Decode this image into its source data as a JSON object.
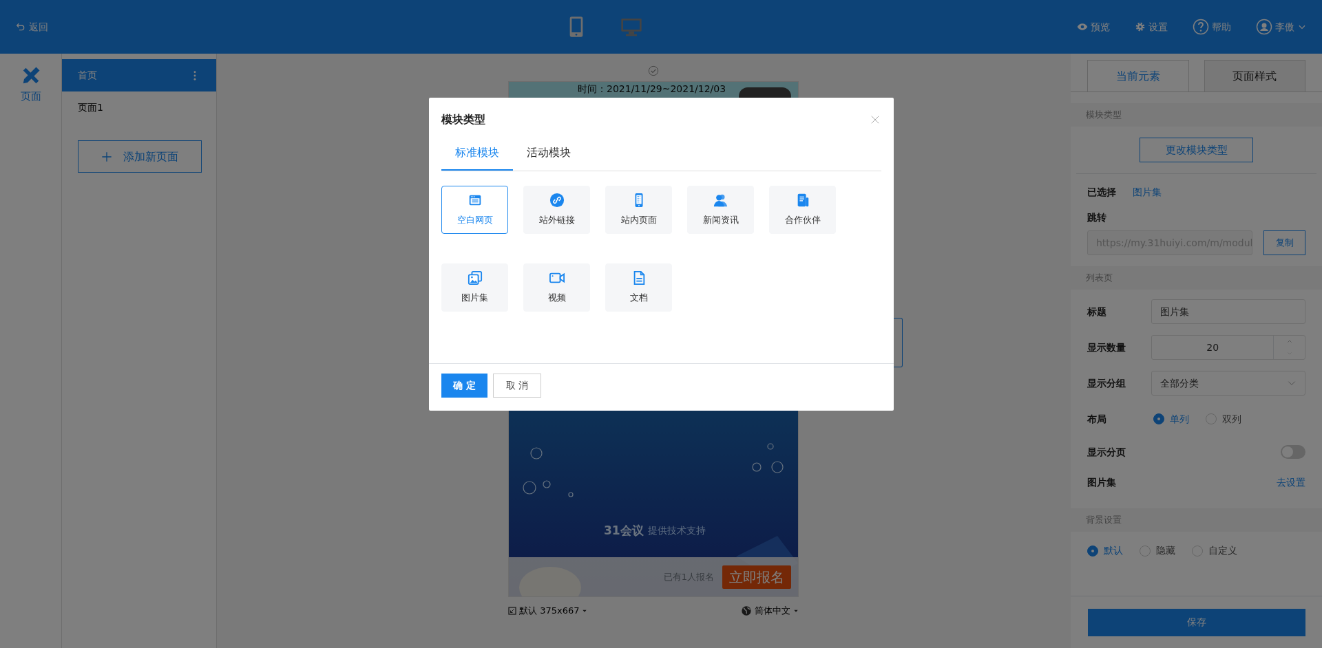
{
  "topbar": {
    "back": "返回",
    "devices": [
      {
        "kind": "phone",
        "selected": true
      },
      {
        "kind": "desktop",
        "selected": false
      }
    ],
    "actions": [
      {
        "kind": "eye",
        "label": "预览"
      },
      {
        "kind": "gear",
        "label": "设置"
      },
      {
        "kind": "help",
        "label": "帮助"
      },
      {
        "kind": "user",
        "label": "李傲"
      }
    ]
  },
  "rail": {
    "label": "页面"
  },
  "pages": [
    {
      "label": "首页",
      "selected": true
    },
    {
      "label": "页面1",
      "selected": false
    }
  ],
  "add_page": "添加新页面",
  "preview": {
    "time": "时间：2021/11/29~2021/12/03",
    "credit_logo": "31会议",
    "credit": "提供技术支持",
    "signup_count": "已有1人报名",
    "signup_button": "立即报名",
    "size": "默认 375x667",
    "language": "简体中文"
  },
  "panel": {
    "tabs": [
      {
        "label": "当前元素",
        "selected": true
      },
      {
        "label": "页面样式",
        "selected": false
      }
    ],
    "module_header": "模块类型",
    "change_button": "更改模块类型",
    "chosen_label": "已选择",
    "chosen_value": "图片集",
    "jump_label": "跳转",
    "jump_url": "https://my.31huiyi.com/m/modul",
    "copy_button": "复制",
    "list_header": "列表页",
    "title_label": "标题",
    "title_value": "图片集",
    "count_label": "显示数量",
    "count_value": "20",
    "group_label": "显示分组",
    "group_value": "全部分类",
    "layout_label": "布局",
    "layout_options": [
      {
        "label": "单列",
        "selected": true
      },
      {
        "label": "双列",
        "selected": false
      }
    ],
    "paging_label": "显示分页",
    "paging_on": false,
    "gallery_label": "图片集",
    "gallery_link": "去设置",
    "bg_header": "背景设置",
    "bg_options": [
      {
        "label": "默认",
        "selected": true
      },
      {
        "label": "隐藏",
        "selected": false
      },
      {
        "label": "自定义",
        "selected": false
      }
    ],
    "save": "保存"
  },
  "modal": {
    "title": "模块类型",
    "tabs": [
      {
        "label": "标准模块",
        "selected": true
      },
      {
        "label": "活动模块",
        "selected": false
      }
    ],
    "modules": [
      {
        "label": "空白网页",
        "kind": "webpage",
        "selected": true
      },
      {
        "label": "站外链接",
        "kind": "link",
        "selected": false
      },
      {
        "label": "站内页面",
        "kind": "phone",
        "selected": false
      },
      {
        "label": "新闻资讯",
        "kind": "people",
        "selected": false
      },
      {
        "label": "合作伙伴",
        "kind": "docs",
        "selected": false
      },
      {
        "label": "图片集",
        "kind": "gallery",
        "selected": false
      },
      {
        "label": "视频",
        "kind": "video",
        "selected": false
      },
      {
        "label": "文档",
        "kind": "file",
        "selected": false
      }
    ],
    "confirm": "确 定",
    "cancel": "取 消"
  }
}
